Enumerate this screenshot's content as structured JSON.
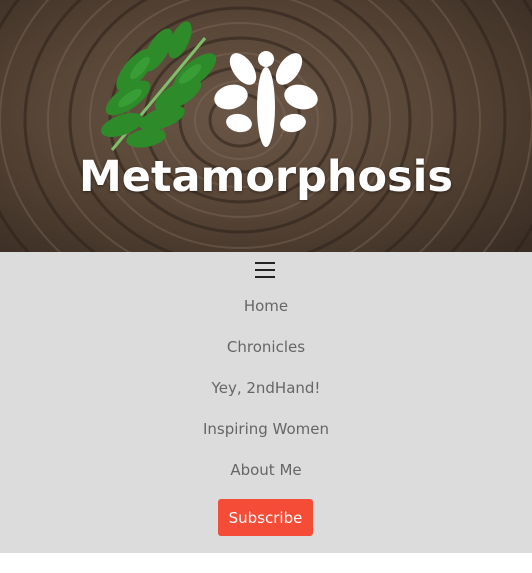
{
  "site": {
    "title": "Metamorphosis"
  },
  "header": {
    "background_icon": "tree-rings-wood",
    "leaf_icon": "green-leaf-icon",
    "logo_icon": "butterfly-icon"
  },
  "nav": {
    "toggle_icon": "hamburger-menu-icon",
    "items": [
      {
        "label": "Home"
      },
      {
        "label": "Chronicles"
      },
      {
        "label": "Yey, 2ndHand!"
      },
      {
        "label": "Inspiring Women"
      },
      {
        "label": "About Me"
      }
    ],
    "subscribe_label": "Subscribe"
  },
  "colors": {
    "nav_background": "#dcdcdc",
    "nav_text": "#666666",
    "subscribe_background": "#f44c36",
    "title_text": "#ffffff"
  }
}
